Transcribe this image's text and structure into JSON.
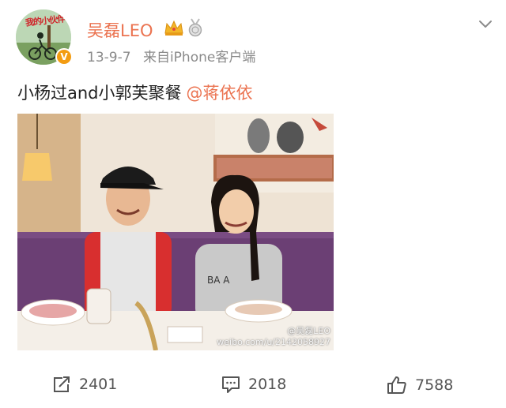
{
  "post": {
    "author": {
      "name": "吴磊LEO",
      "avatar_text": "我的小伙伴",
      "verified_icon": "verified-v-icon",
      "verified_label": "V"
    },
    "time": "13-9-7",
    "source": "来自iPhone客户端",
    "text": "小杨过and小郭芙聚餐",
    "mention": "@蒋依依",
    "image": {
      "watermark": "weibo.com/u/2142058927",
      "watermark_id": "@吴磊LEO"
    },
    "actions": {
      "repost_count": "2401",
      "comment_count": "2018",
      "like_count": "7588"
    }
  },
  "colors": {
    "username": "#eb7350",
    "mention": "#eb7350",
    "meta_text": "#8a8a8a",
    "verified_badge": "#f39c12"
  },
  "icons": [
    "crown-icon",
    "medal-icon",
    "chevron-down-icon",
    "repost-icon",
    "comment-icon",
    "like-icon"
  ]
}
